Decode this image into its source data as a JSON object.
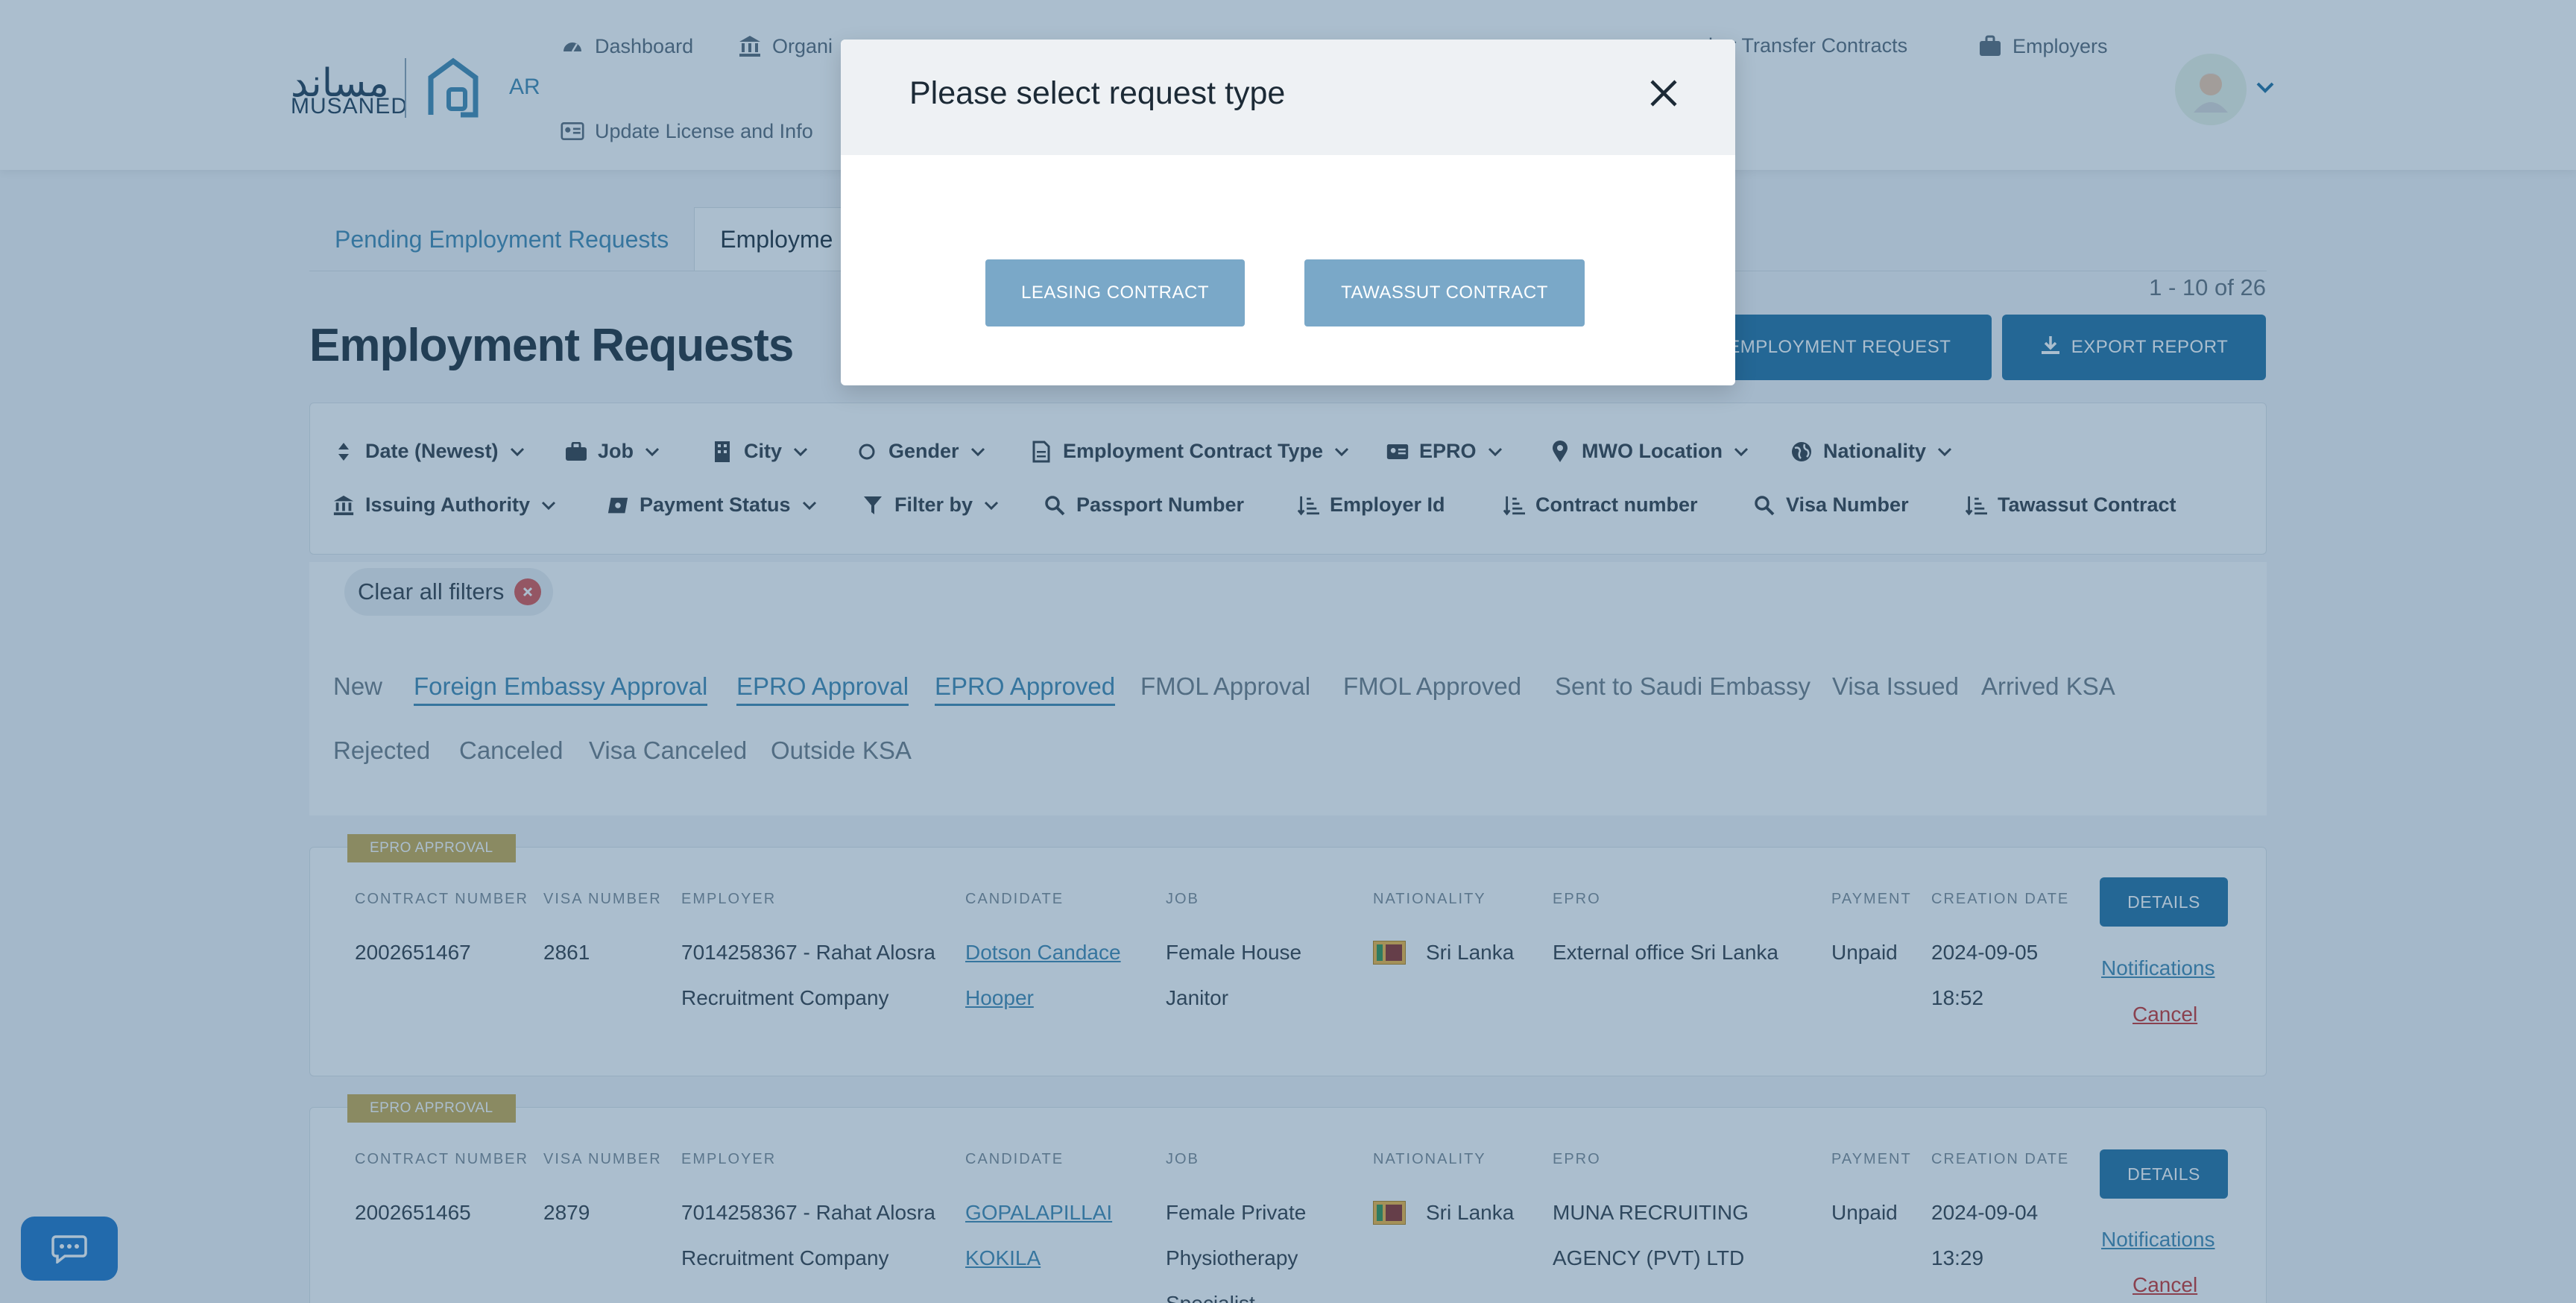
{
  "header": {
    "logo_ar": "مساند",
    "logo_en": "MUSANED",
    "lang_toggle": "AR",
    "nav": [
      {
        "label": "Dashboard",
        "icon": "dashboard-icon"
      },
      {
        "label": "Organi",
        "icon": "institution-icon"
      },
      {
        "label": "ker Transfer Contracts",
        "icon": "contract-icon"
      },
      {
        "label": "Employers",
        "icon": "briefcase-icon"
      },
      {
        "label": "Update License and Info",
        "icon": "id-card-icon"
      }
    ]
  },
  "tabs": {
    "pending": "Pending Employment Requests",
    "active": "Employme"
  },
  "pagination": "1 - 10 of 26",
  "page_title": "Employment Requests",
  "actions": {
    "new_request": "V EMPLOYMENT REQUEST",
    "export": "EXPORT REPORT"
  },
  "filters": {
    "row1": [
      "Date (Newest)",
      "Job",
      "City",
      "Gender",
      "Employment Contract Type",
      "EPRO",
      "MWO Location",
      "Nationality"
    ],
    "row2": [
      "Issuing Authority",
      "Payment Status",
      "Filter by",
      "Passport Number",
      "Employer Id",
      "Contract number",
      "Visa Number",
      "Tawassut Contract"
    ]
  },
  "clear_filters": "Clear all filters",
  "statuses": {
    "row1": [
      "New",
      "Foreign Embassy Approval",
      "EPRO Approval",
      "EPRO Approved",
      "FMOL Approval",
      "FMOL Approved",
      "Sent to Saudi Embassy",
      "Visa Issued",
      "Arrived KSA"
    ],
    "row2": [
      "Rejected",
      "Canceled",
      "Visa Canceled",
      "Outside KSA"
    ]
  },
  "columns": [
    "CONTRACT NUMBER",
    "VISA NUMBER",
    "EMPLOYER",
    "CANDIDATE",
    "JOB",
    "NATIONALITY",
    "EPRO",
    "PAYMENT",
    "CREATION DATE"
  ],
  "cards": [
    {
      "badge": "EPRO APPROVAL",
      "contract_number": "2002651467",
      "visa_number": "2861",
      "employer_l1": "7014258367 - Rahat Alosra",
      "employer_l2": "Recruitment Company",
      "candidate_l1": "Dotson Candace",
      "candidate_l2": "Hooper",
      "job_l1": "Female House",
      "job_l2": "Janitor",
      "job_l3": "",
      "nationality": "Sri Lanka",
      "epro_l1": "External office Sri Lanka",
      "epro_l2": "",
      "payment": "Unpaid",
      "date_l1": "2024-09-05",
      "date_l2": "18:52",
      "details": "DETAILS",
      "notifications": "Notifications",
      "cancel": "Cancel"
    },
    {
      "badge": "EPRO APPROVAL",
      "contract_number": "2002651465",
      "visa_number": "2879",
      "employer_l1": "7014258367 - Rahat Alosra",
      "employer_l2": "Recruitment Company",
      "candidate_l1": "GOPALAPILLAI",
      "candidate_l2": "KOKILA",
      "job_l1": "Female Private",
      "job_l2": "Physiotherapy",
      "job_l3": "Specialist",
      "nationality": "Sri Lanka",
      "epro_l1": "MUNA RECRUITING",
      "epro_l2": "AGENCY (PVT) LTD",
      "payment": "Unpaid",
      "date_l1": "2024-09-04",
      "date_l2": "13:29",
      "details": "DETAILS",
      "notifications": "Notifications",
      "cancel": "Cancel"
    }
  ],
  "modal": {
    "title": "Please select request type",
    "leasing": "LEASING CONTRACT",
    "tawassut": "TAWASSUT CONTRACT"
  },
  "colors": {
    "primary": "#1e6fa1",
    "link": "#3c86b0",
    "badge": "#c8a94b",
    "danger": "#c9302c",
    "overlay": "rgba(46,92,132,0.40)"
  }
}
